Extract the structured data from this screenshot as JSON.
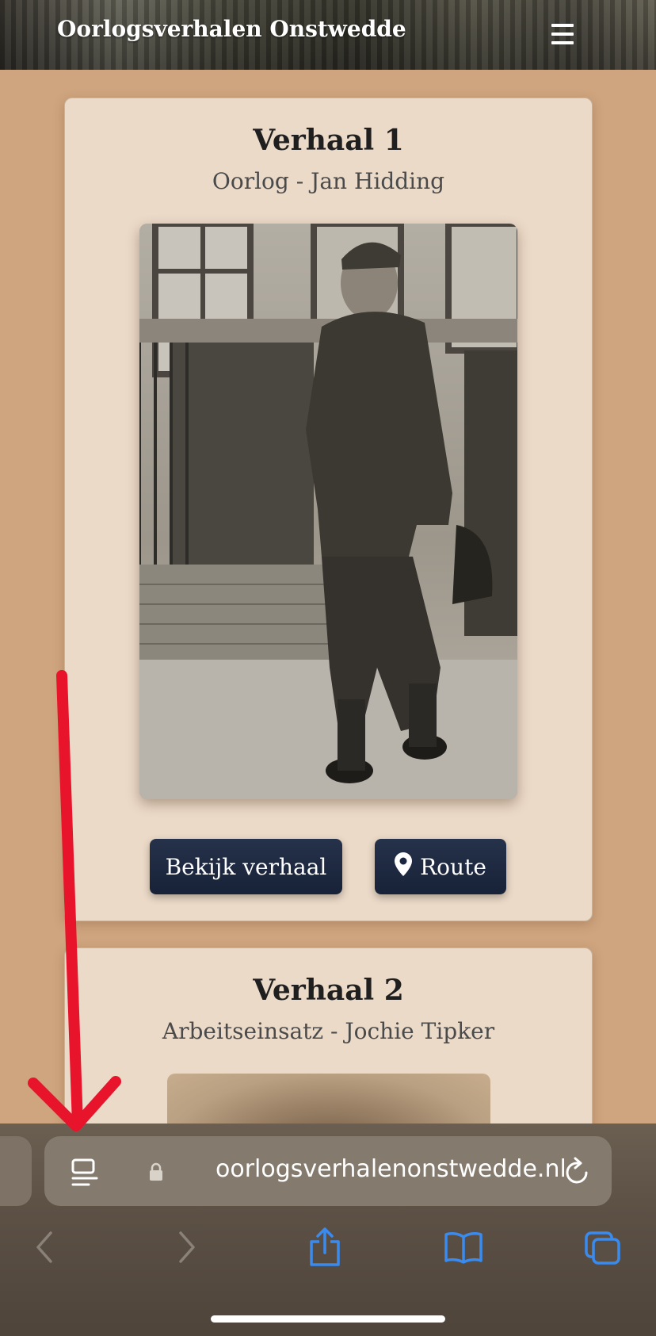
{
  "header": {
    "title": "Oorlogsverhalen Onstwedde",
    "menu_icon": "hamburger-menu-icon"
  },
  "stories": [
    {
      "title": "Verhaal 1",
      "subtitle": "Oorlog - Jan Hidding",
      "photo": "sepia-portrait-soldier",
      "buttons": {
        "view_label": "Bekijk verhaal",
        "route_label": "Route",
        "route_icon": "map-pin-icon"
      }
    },
    {
      "title": "Verhaal 2",
      "subtitle": "Arbeitseinsatz - Jochie Tipker",
      "photo": "sepia-portrait"
    }
  ],
  "browser": {
    "url": "oorlogsverhalenonstwedde.nl",
    "icons": [
      "reader-mode-icon",
      "lock-icon",
      "reload-icon",
      "back-icon",
      "forward-icon",
      "share-icon",
      "bookmarks-icon",
      "tabs-icon"
    ]
  },
  "annotation": {
    "type": "red-arrow",
    "color": "#e8142c"
  },
  "colors": {
    "page_background": "#cfa57f",
    "card_background": "#ecdac8",
    "button_background": "#1b2640",
    "accent_blue": "#3a8bf0"
  }
}
